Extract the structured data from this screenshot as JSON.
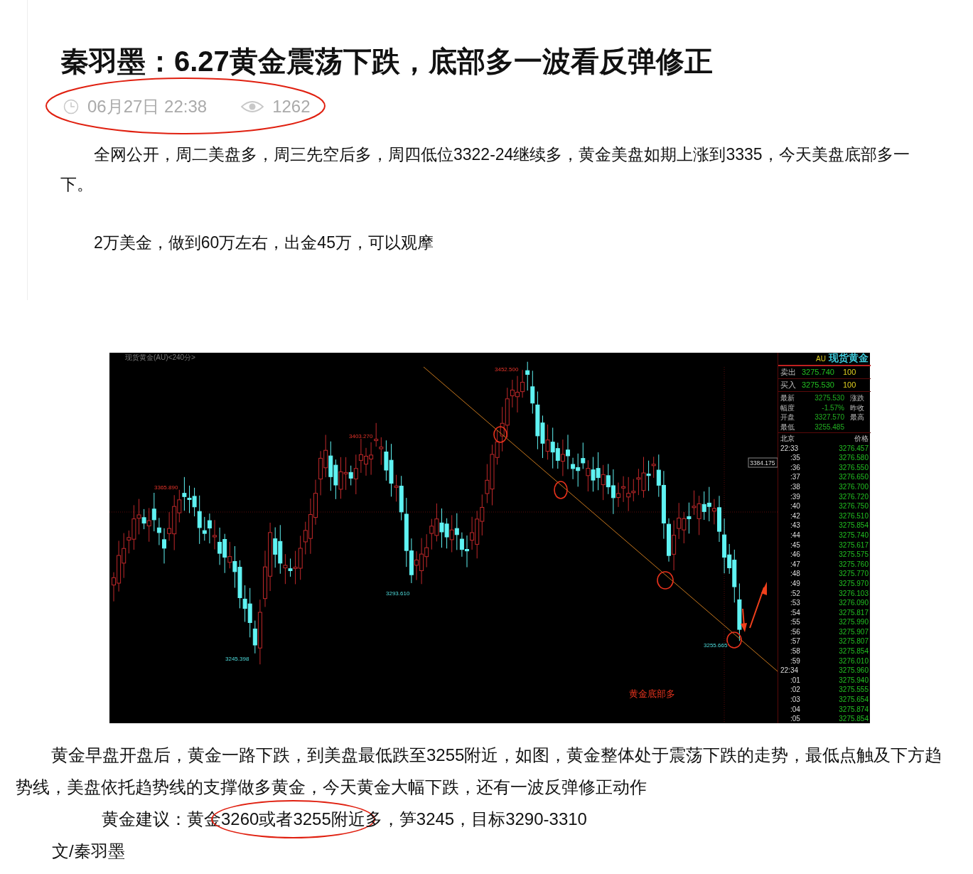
{
  "article": {
    "title": "秦羽墨：6.27黄金震荡下跌，底部多一波看反弹修正",
    "meta": {
      "time": "06月27日 22:38",
      "views": "1262"
    },
    "intro_paragraphs": [
      "全网公开，周二美盘多，周三先空后多，周四低位3322-24继续多，黄金美盘如期上涨到3335，今天美盘底部多一下。",
      "2万美金，做到60万左右，出金45万，可以观摩"
    ]
  },
  "figure": {
    "chart_title": "现货黄金(AU)<240分>",
    "price_labels": [
      {
        "text": "3452.500",
        "kind": "high"
      },
      {
        "text": "3403.270",
        "kind": "high"
      },
      {
        "text": "3365.890",
        "kind": "high"
      },
      {
        "text": "3293.610",
        "kind": "low"
      },
      {
        "text": "3245.398",
        "kind": "low"
      },
      {
        "text": "3255.665",
        "kind": "low"
      }
    ],
    "cursor_price": "3384.175",
    "annotation": "黄金底部多",
    "quote_panel": {
      "symbol": "AU",
      "name": "现货黄金",
      "orders": [
        {
          "label": "卖出",
          "price": "3275.740",
          "volume": "100"
        },
        {
          "label": "买入",
          "price": "3275.530",
          "volume": "100"
        }
      ],
      "stats": [
        {
          "label": "最新",
          "value": "3275.530",
          "side_label": "涨跌"
        },
        {
          "label": "幅度",
          "value": "-1.57%",
          "side_label": "昨收"
        },
        {
          "label": "开盘",
          "value": "3327.570",
          "side_label": "最高"
        },
        {
          "label": "最低",
          "value": "3255.485"
        }
      ],
      "ticks_header": {
        "time": "北京",
        "price": "价格"
      },
      "ticks": [
        {
          "time": "22:33",
          "price": "3276.457"
        },
        {
          "time": ":35",
          "price": "3276.580"
        },
        {
          "time": ":36",
          "price": "3276.550"
        },
        {
          "time": ":37",
          "price": "3276.650"
        },
        {
          "time": ":38",
          "price": "3276.700"
        },
        {
          "time": ":39",
          "price": "3276.720"
        },
        {
          "time": ":40",
          "price": "3276.750"
        },
        {
          "time": ":42",
          "price": "3276.510"
        },
        {
          "time": ":43",
          "price": "3275.854"
        },
        {
          "time": ":44",
          "price": "3275.740"
        },
        {
          "time": ":45",
          "price": "3275.617"
        },
        {
          "time": ":46",
          "price": "3275.575"
        },
        {
          "time": ":47",
          "price": "3275.760"
        },
        {
          "time": ":48",
          "price": "3275.770"
        },
        {
          "time": ":49",
          "price": "3275.970"
        },
        {
          "time": ":52",
          "price": "3276.103"
        },
        {
          "time": ":53",
          "price": "3276.090"
        },
        {
          "time": ":54",
          "price": "3275.817"
        },
        {
          "time": ":55",
          "price": "3275.990"
        },
        {
          "time": ":56",
          "price": "3275.907"
        },
        {
          "time": ":57",
          "price": "3275.807"
        },
        {
          "time": ":58",
          "price": "3275.854"
        },
        {
          "time": ":59",
          "price": "3276.010"
        },
        {
          "time": "22:34",
          "price": "3275.960"
        },
        {
          "time": ":01",
          "price": "3275.940"
        },
        {
          "time": ":02",
          "price": "3275.555"
        },
        {
          "time": ":03",
          "price": "3275.654"
        },
        {
          "time": ":04",
          "price": "3275.874"
        },
        {
          "time": ":05",
          "price": "3275.854"
        }
      ]
    }
  },
  "body_paragraphs": [
    "黄金早盘开盘后，黄金一路下跌，到美盘最低跌至3255附近，如图，黄金整体处于震荡下跌的走势，最低点触及下方趋势线，美盘依托趋势线的支撑做多黄金，今天黄金大幅下跌，还有一波反弹修正动作"
  ],
  "advice": [
    {
      "text": "黄金建议：黄金",
      "highlighted": false
    },
    {
      "text": "3260或者3255附近",
      "highlighted": true
    },
    {
      "text": "多，笋3245，目标3290-3310",
      "highlighted": false
    }
  ],
  "byline": "文/秦羽墨"
}
